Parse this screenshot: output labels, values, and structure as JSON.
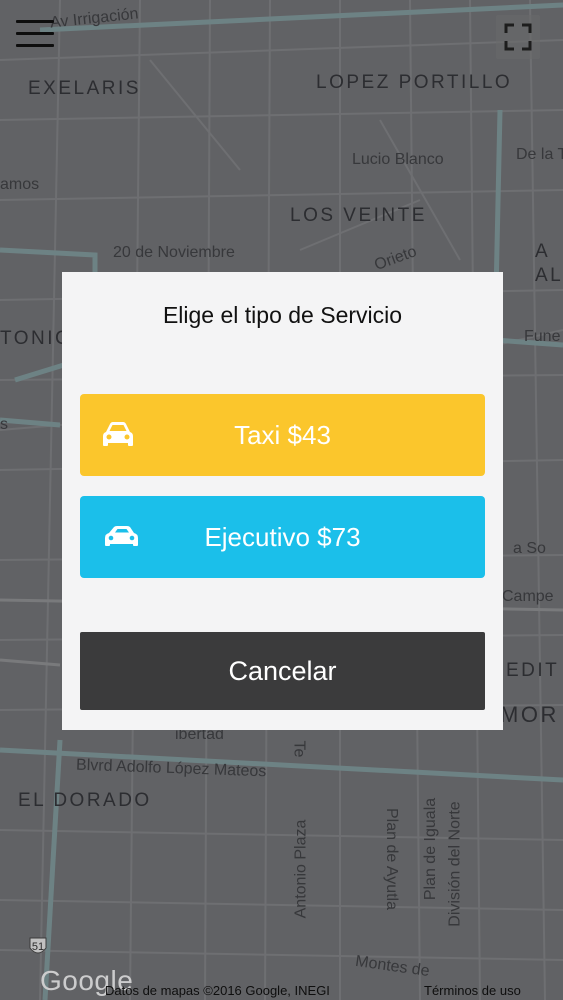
{
  "map": {
    "neighborhoods": {
      "exelaris": "EXELARIS",
      "lopez_portillo": "LOPEZ PORTILLO",
      "los_veinte": "LOS VEINTE",
      "tonic": "TONIC",
      "a_al": "A\nAL",
      "el_dorado": "EL DORADO",
      "edit": "EDIT",
      "mor": "MOR"
    },
    "streets": {
      "av_irrigacion": "Av Irrigación",
      "lucio_blanco": "Lucio Blanco",
      "de_la": "De la T",
      "amos": "amos",
      "veinte_noviembre": "20 de Noviembre",
      "orieto": "Orieto",
      "fune": "Fune",
      "s_left": "s",
      "campe": "Campe",
      "la_so": "a So",
      "blvrd": "Blvrd Adolfo López Mateos",
      "ibertad": "ibertad",
      "antonio_plaza": "Antonio Plaza",
      "plan_de_ayutla": "Plan de Ayutla",
      "plan_de_iguala": "Plan de Iguala",
      "division_del_norte": "División del Norte",
      "montes_de": "Montes de",
      "te": "Te"
    },
    "route_shield": "51",
    "google_logo": "Google",
    "attribution": "Datos de mapas ©2016 Google, INEGI",
    "terms": "Términos de uso"
  },
  "dialog": {
    "title": "Elige el tipo de Servicio",
    "options": [
      {
        "label": "Taxi $43",
        "icon": "car-icon",
        "color": "#fbc62c"
      },
      {
        "label": "Ejecutivo $73",
        "icon": "car-icon",
        "color": "#1bbfea"
      }
    ],
    "cancel_label": "Cancelar"
  },
  "colors": {
    "taxi": "#fbc62c",
    "ejecutivo": "#1bbfea",
    "cancel": "#3b3b3c",
    "map_bg": "#6f7073"
  }
}
